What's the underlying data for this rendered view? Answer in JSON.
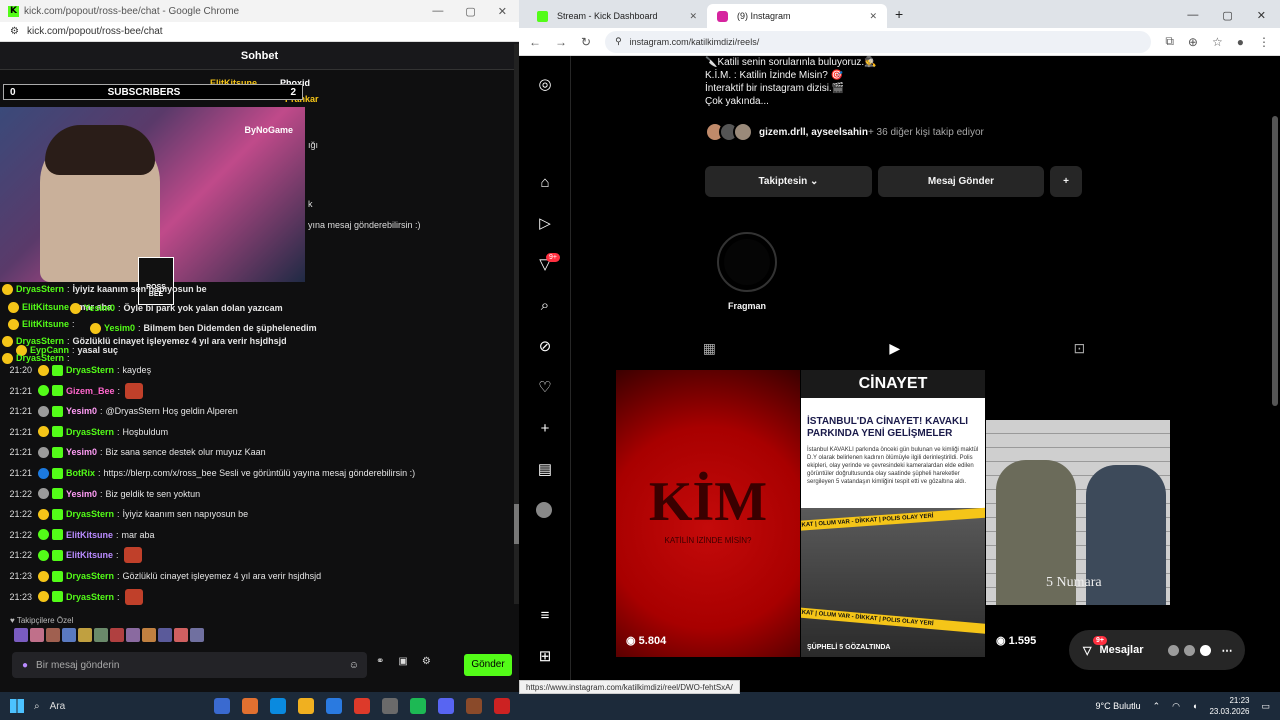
{
  "left_window": {
    "title": "kick.com/popout/ross-bee/chat - Google Chrome",
    "url": "kick.com/popout/ross-bee/chat",
    "panel_title": "Sohbet",
    "subs_label": "SUBSCRIBERS",
    "subs_left": "0",
    "subs_right": "2",
    "cam_tag": "ByNoGame",
    "cam_logo": "ROSS BEE",
    "top_users": [
      "ElitKitsune",
      "Phoxid",
      "Prankar"
    ],
    "followers_label": "Takipçilere Özel",
    "input_placeholder": "Bir mesaj gönderin",
    "send_label": "Gönder"
  },
  "overlay_lines": [
    {
      "name": "DryasStern",
      "text": "İyiyiz kaanım sen napıyosun be"
    },
    {
      "name": "ElitKitsune",
      "text": "mar aba"
    },
    {
      "name": "Yesim0",
      "text": "Öyle bi park yok yalan dolan yazıcam"
    },
    {
      "name": "ElitKitsune",
      "text": ""
    },
    {
      "name": "Yesim0",
      "text": "Bilmem ben Didemden de şüphelenedim"
    },
    {
      "name": "DryasStern",
      "text": "Gözlüklü cinayet işleyemez 4 yıl ara verir hsjdhsjd"
    },
    {
      "name": "EypCann",
      "text": "yasal suç"
    },
    {
      "name": "DryasStern",
      "text": ""
    }
  ],
  "behind_fragments": [
    "ığı",
    "k",
    "yına mesaj gönderebilirsin :)"
  ],
  "chat": [
    {
      "time": "21:20",
      "name": "DryasStern",
      "text": "kaydeş",
      "color": "g"
    },
    {
      "time": "21:21",
      "name": "Gizem_Bee",
      "text": "",
      "color": "p"
    },
    {
      "time": "21:21",
      "name": "Yesim0",
      "text": "@DryasStern Hoş geldin Alperen",
      "color": "y"
    },
    {
      "time": "21:21",
      "name": "DryasStern",
      "text": "Hoşbuldum",
      "color": "g"
    },
    {
      "time": "21:21",
      "name": "Yesim0",
      "text": "Biz sana sence destek olur muyuz Kaan",
      "color": "y"
    },
    {
      "time": "21:21",
      "name": "BotRix",
      "text": "https://blerp.com/x/ross_bee Sesli ve görüntülü yayına mesaj gönderebilirsin :)",
      "color": "t"
    },
    {
      "time": "21:22",
      "name": "Yesim0",
      "text": "Biz geldik te sen yoktun",
      "color": "y"
    },
    {
      "time": "21:22",
      "name": "DryasStern",
      "text": "İyiyiz kaanım sen napıyosun be",
      "color": "g"
    },
    {
      "time": "21:22",
      "name": "ElitKitsune",
      "text": "mar aba",
      "color": "v"
    },
    {
      "time": "21:22",
      "name": "ElitKitsune",
      "text": "",
      "color": "v"
    },
    {
      "time": "21:23",
      "name": "DryasStern",
      "text": "Gözlüklü cinayet işleyemez 4 yıl ara verir hsjdhsjd",
      "color": "g"
    },
    {
      "time": "21:23",
      "name": "DryasStern",
      "text": "",
      "color": "g"
    }
  ],
  "right_window": {
    "tabs": [
      "Stream - Kick Dashboard",
      "(9) Instagram"
    ],
    "url": "instagram.com/katilkimdizi/reels/",
    "bio": [
      "🔪Katili senin sorularınla buluyoruz.🕵",
      "K.İ.M. : Katilin İzinde Misin? 🎯",
      "İnteraktif bir instagram dizisi.🎬",
      "Çok yakında..."
    ],
    "followed_by_names": "gizem.drll, ayseelsahin",
    "followed_by_rest": " + 36 diğer kişi takip ediyor",
    "follow_btn": "Takiptesin",
    "message_btn": "Mesaj Gönder",
    "highlight_label": "Fragman",
    "notification_badge": "9+",
    "reels": [
      {
        "title": "KİM",
        "subtitle": "KATİLİN İZİNDE MİSİN?",
        "views": "5.804"
      },
      {
        "banner": "CİNAYET",
        "headline": "İSTANBUL'DA CİNAYET! KAVAKLI PARKINDA YENİ GELİŞMELER",
        "body": "İstanbul KAVAKLI parkında önceki gün bulunan ve kimliği maktül D.Y olarak belirlenen kadının ölümüyle ilgili derinleştirildi. Polis ekipleri, olay yerinde ve çevresindeki kameralardan elde edilen görüntüler doğrultusunda olay saatinde şüpheli hareketler sergileyen 5 vatandaşın kimliğini tespit etti ve gözaltına aldı.",
        "caption": "ŞÜPHELİ 5 GÖZALTINDA",
        "tape": "DİKKAT | OLUM VAR - DİKKAT | POLIS OLAY YERİ",
        "views": ""
      },
      {
        "label": "5 Numara",
        "views": "1.595"
      }
    ],
    "messages_label": "Mesajlar",
    "messages_badge": "9+",
    "status_url": "https://www.instagram.com/katilkimdizi/reel/DWO-fehtSxA/"
  },
  "taskbar": {
    "search": "Ara",
    "weather": "9°C  Bulutlu",
    "time": "21:23",
    "date": "23.03.2026"
  },
  "colors": {
    "kick_green": "#53fc18",
    "ig_badge": "#ff3040"
  }
}
